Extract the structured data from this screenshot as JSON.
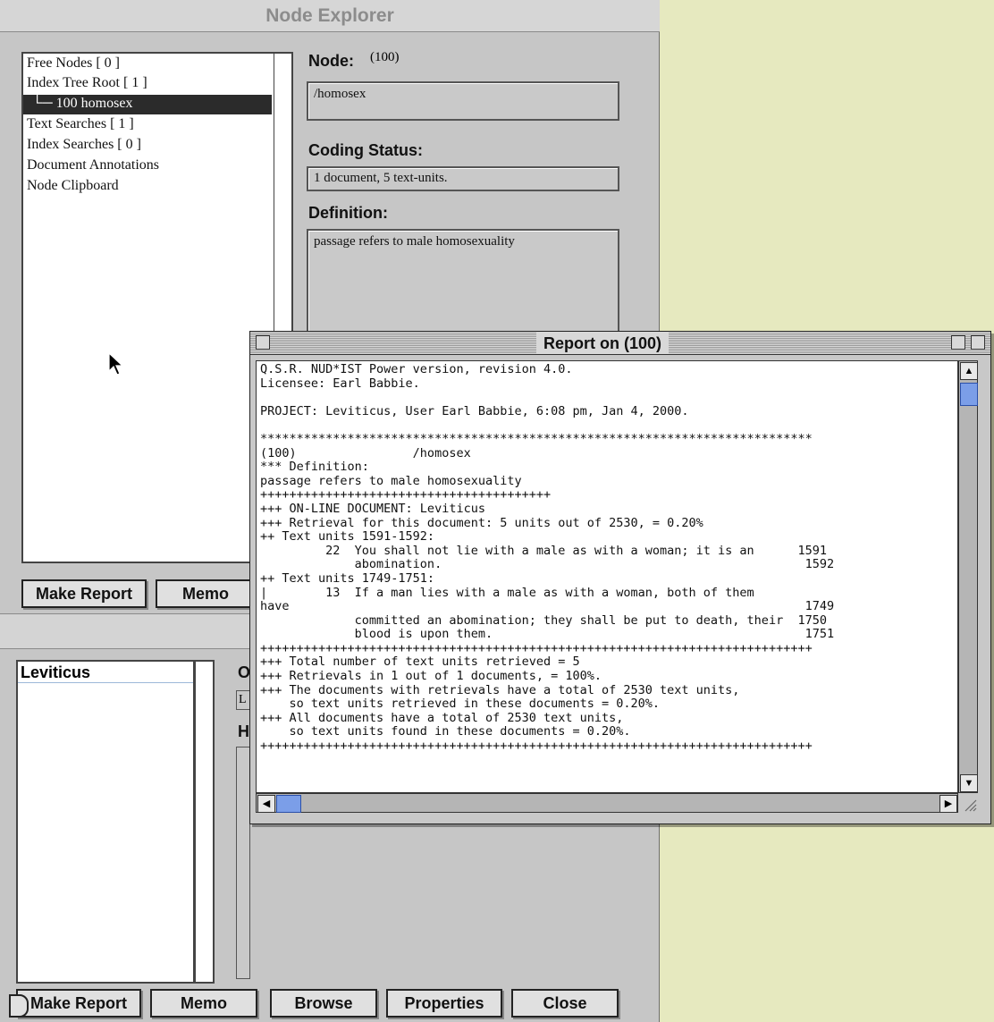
{
  "node_explorer": {
    "title": "Node Explorer",
    "tree_items": [
      "Free Nodes [ 0 ]",
      "Index Tree Root [ 1 ]",
      "└─ 100  homosex",
      "Text Searches [ 1 ]",
      "Index Searches [ 0 ]",
      "Document Annotations",
      "Node Clipboard"
    ],
    "node_label": "Node:",
    "node_number": "(100)",
    "node_value": "/homosex",
    "coding_label": "Coding Status:",
    "coding_value": "1 document, 5 text-units.",
    "definition_label": "Definition:",
    "definition_value": "passage refers to male homosexuality",
    "make_report": "Make Report",
    "memo": "Memo"
  },
  "document_explorer": {
    "list_items": [
      "Leviticus"
    ],
    "partial_label_o": "O",
    "partial_label_h": "H",
    "partial_field_l": "L",
    "buttons": {
      "make_report": "Make Report",
      "memo": "Memo",
      "browse": "Browse",
      "properties": "Properties",
      "close": "Close"
    }
  },
  "report": {
    "title": "Report on (100)",
    "lines": [
      "Q.S.R. NUD*IST Power version, revision 4.0.",
      "Licensee: Earl Babbie.",
      "",
      "PROJECT: Leviticus, User Earl Babbie, 6:08 pm, Jan 4, 2000.",
      "",
      "****************************************************************************",
      "(100)                /homosex",
      "*** Definition:",
      "passage refers to male homosexuality",
      "++++++++++++++++++++++++++++++++++++++++",
      "+++ ON-LINE DOCUMENT: Leviticus",
      "+++ Retrieval for this document: 5 units out of 2530, = 0.20%",
      "++ Text units 1591-1592:",
      "         22  You shall not lie with a male as with a woman; it is an      1591",
      "             abomination.                                                  1592",
      "++ Text units 1749-1751:",
      "|        13  If a man lies with a male as with a woman, both of them",
      "have                                                                       1749",
      "             committed an abomination; they shall be put to death, their  1750",
      "             blood is upon them.                                           1751",
      "++++++++++++++++++++++++++++++++++++++++++++++++++++++++++++++++++++++++++++",
      "+++ Total number of text units retrieved = 5",
      "+++ Retrievals in 1 out of 1 documents, = 100%.",
      "+++ The documents with retrievals have a total of 2530 text units,",
      "    so text units retrieved in these documents = 0.20%.",
      "+++ All documents have a total of 2530 text units,",
      "    so text units found in these documents = 0.20%.",
      "++++++++++++++++++++++++++++++++++++++++++++++++++++++++++++++++++++++++++++"
    ]
  }
}
